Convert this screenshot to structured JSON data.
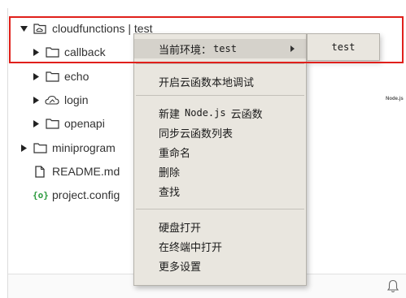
{
  "explorer": {
    "root": {
      "label": "cloudfunctions | test",
      "expanded": true
    },
    "items": [
      {
        "label": "callback",
        "icon": "folder-icon",
        "expanded": false
      },
      {
        "label": "echo",
        "icon": "folder-icon",
        "expanded": false
      },
      {
        "label": "login",
        "icon": "cloud-icon",
        "expanded": false
      },
      {
        "label": "openapi",
        "icon": "folder-icon",
        "expanded": false
      }
    ],
    "top_items": [
      {
        "label": "miniprogram",
        "icon": "folder-icon",
        "expanded": false
      },
      {
        "label": "README.md",
        "icon": "file-icon"
      },
      {
        "label": "project.config",
        "icon": "braces-icon"
      }
    ]
  },
  "context_menu": {
    "env_label": "当前环境：",
    "env_value": "test",
    "items_group1": [
      "开启云函数本地调试"
    ],
    "new_node_prefix": "新建",
    "new_node_mono": "Node.js",
    "new_node_suffix": "云函数",
    "items_group2": [
      "同步云函数列表",
      "重命名",
      "删除",
      "查找"
    ],
    "items_group3": [
      "硬盘打开",
      "在终端中打开",
      "更多设置"
    ]
  },
  "submenu": {
    "items": [
      "test"
    ]
  },
  "side_tag": "Node.js",
  "colors": {
    "highlight": "#e0201b",
    "menu_bg": "#e9e6df",
    "config_icon": "#2b9a3d"
  }
}
